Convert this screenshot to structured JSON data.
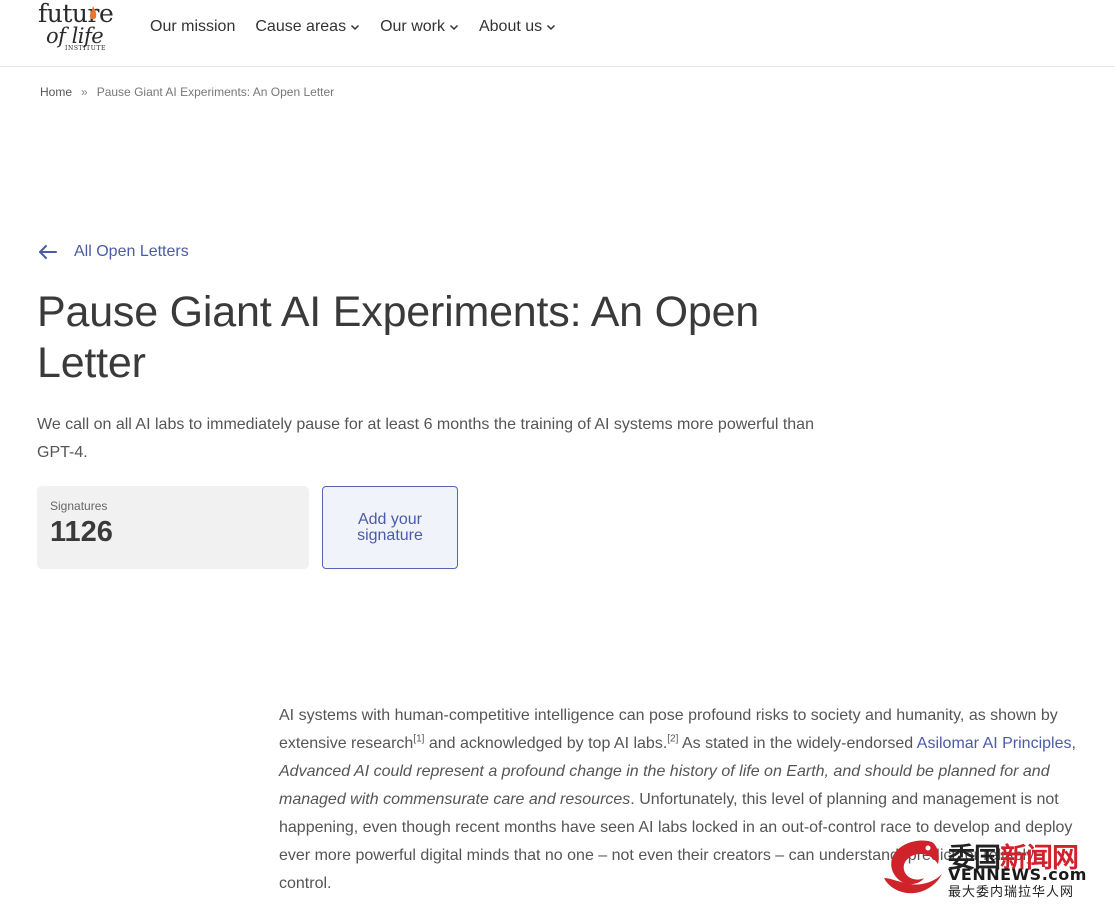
{
  "logo": {
    "line1": "future",
    "line2": "of life",
    "line3": "INSTITUTE"
  },
  "nav": {
    "items": [
      {
        "label": "Our mission"
      },
      {
        "label": "Cause areas"
      },
      {
        "label": "Our work"
      },
      {
        "label": "About us"
      }
    ]
  },
  "breadcrumb": {
    "home": "Home",
    "separator": "»",
    "current": "Pause Giant AI Experiments: An Open Letter"
  },
  "back_link": "All Open Letters",
  "title": "Pause Giant AI Experiments: An Open Letter",
  "subtitle": "We call on all AI labs to immediately pause for at least 6 months the training of AI systems more powerful than GPT-4.",
  "signatures": {
    "label": "Signatures",
    "count": "1126"
  },
  "add_signature_label": "Add your signature",
  "body": {
    "p1_a": "AI systems with human-competitive intelligence can pose profound risks to society and humanity, as shown by extensive research",
    "ref1": "[1]",
    "p1_b": " and acknowledged by top AI labs.",
    "ref2": "[2]",
    "p1_c": " As stated in the widely-endorsed ",
    "link": "Asilomar AI Principles",
    "p1_d": ", ",
    "italic": "Advanced AI could represent a profound change in the history of life on Earth, and should be planned for and managed with commensurate care and resources",
    "p1_e": ". Unfortunately, this level of planning and management is not happening, even though recent months have seen AI labs locked in an out-of-control race to develop and deploy ever more powerful digital minds that no one – not even their creators – can understand, predict, or reliably control."
  },
  "watermark": {
    "cn_a": "委国",
    "cn_b": "新闻网",
    "en": "VENNEWS.com",
    "sub": "最大委内瑞拉华人网"
  },
  "colors": {
    "link": "#4a5ba8",
    "text": "#3a3a3a",
    "muted": "#555555",
    "flame": "#e8762d",
    "watermark_red": "#d0222a"
  }
}
